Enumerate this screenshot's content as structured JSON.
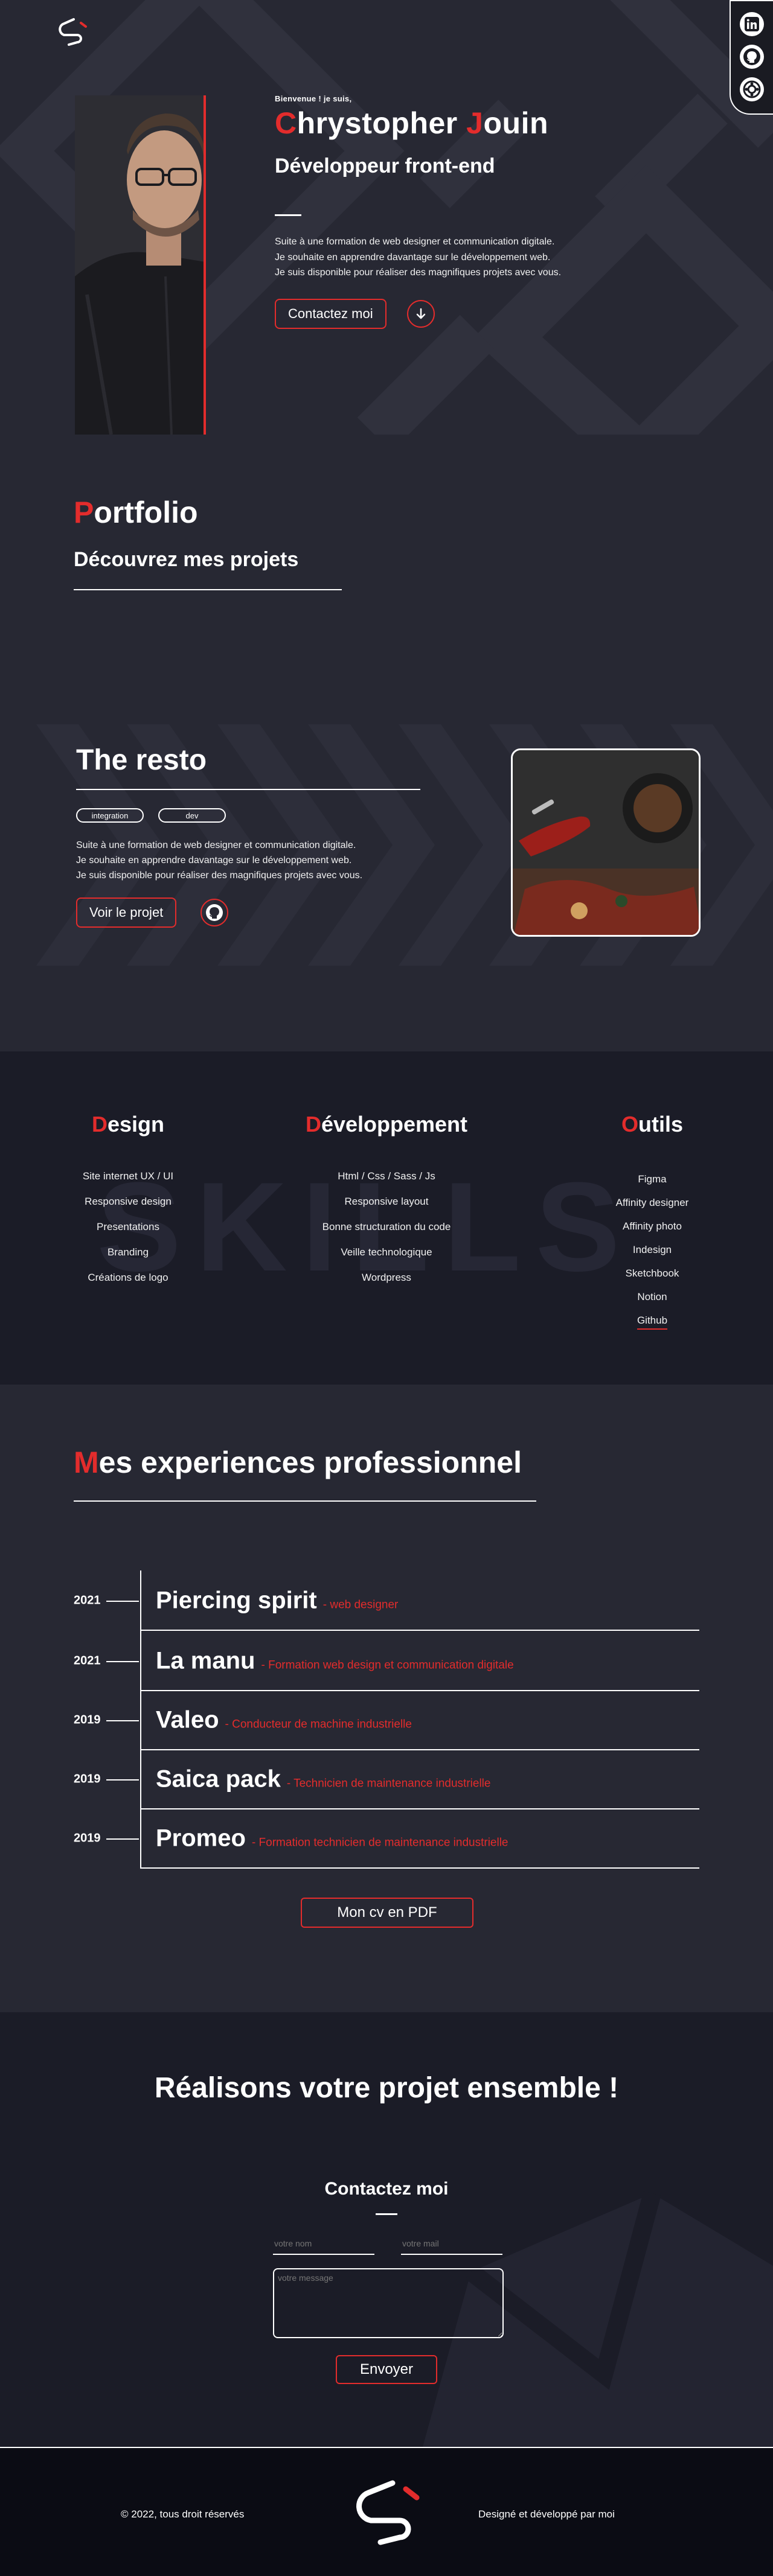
{
  "colors": {
    "accent": "#e32c2c",
    "background": "#272833",
    "background_dark": "#1b1c27",
    "footer": "#0b0c14"
  },
  "header": {
    "logo": "logo-icon",
    "social": [
      {
        "name": "LinkedIn",
        "icon": "linkedin-icon"
      },
      {
        "name": "GitHub",
        "icon": "github-icon"
      },
      {
        "name": "Portfolio",
        "icon": "gear-icon"
      }
    ]
  },
  "hero": {
    "greeting": "Bienvenue ! je suis,",
    "first_initial": "C",
    "first_rest": "hrystopher ",
    "last_initial": "J",
    "last_rest": "ouin",
    "job": "Développeur front-end",
    "intro_lines": [
      "Suite à une formation de web designer et communication digitale.",
      "Je souhaite en apprendre davantage sur le développement web.",
      "Je suis disponible pour réaliser des magnifiques projets avec vous."
    ],
    "contact_button": "Contactez moi",
    "scroll_icon": "arrow-down-icon"
  },
  "portfolio": {
    "title_initial": "P",
    "title_rest": "ortfolio",
    "subtitle": "Découvrez mes projets",
    "project": {
      "title": "The resto",
      "tags": [
        "integration",
        "dev"
      ],
      "description_lines": [
        "Suite à une formation de web designer et communication digitale.",
        "Je souhaite en apprendre davantage sur le développement web.",
        "Je suis disponible pour réaliser des magnifiques projets avec vous."
      ],
      "button": "Voir le projet",
      "github_icon": "github-icon"
    }
  },
  "skills": {
    "watermark": "SKILLS",
    "columns": [
      {
        "initial": "D",
        "rest": "esign",
        "items": [
          "Site internet UX / UI",
          "Responsive design",
          "Presentations",
          "Branding",
          "Créations de logo"
        ]
      },
      {
        "initial": "D",
        "rest": "éveloppement",
        "items": [
          "Html / Css / Sass / Js",
          "Responsive layout",
          "Bonne structuration du code",
          "Veille technologique",
          "Wordpress"
        ]
      },
      {
        "initial": "O",
        "rest": "utils",
        "items": [
          "Figma",
          "Affinity designer",
          "Affinity photo",
          "Indesign",
          "Sketchbook",
          "Notion",
          "Github"
        ]
      }
    ]
  },
  "experiences": {
    "title_initial": "M",
    "title_rest": "es experiences professionnel",
    "items": [
      {
        "year": "2021",
        "company": "Piercing spirit",
        "role": "- web designer"
      },
      {
        "year": "2021",
        "company": "La manu",
        "role": "- Formation web design et communication digitale"
      },
      {
        "year": "2019",
        "company": "Valeo",
        "role": "- Conducteur de machine industrielle"
      },
      {
        "year": "2019",
        "company": "Saica pack",
        "role": "- Technicien de maintenance industrielle"
      },
      {
        "year": "2019",
        "company": "Promeo",
        "role": "- Formation technicien de maintenance industrielle"
      }
    ],
    "cv_button": "Mon cv en PDF"
  },
  "contact": {
    "title": "Réalisons votre projet ensemble !",
    "form_title": "Contactez moi",
    "name_placeholder": "votre nom",
    "mail_placeholder": "votre mail",
    "message_placeholder": "votre message",
    "send_button": "Envoyer"
  },
  "footer": {
    "copyright": "© 2022, tous droit réservés",
    "credits": "Designé et développé par moi"
  }
}
